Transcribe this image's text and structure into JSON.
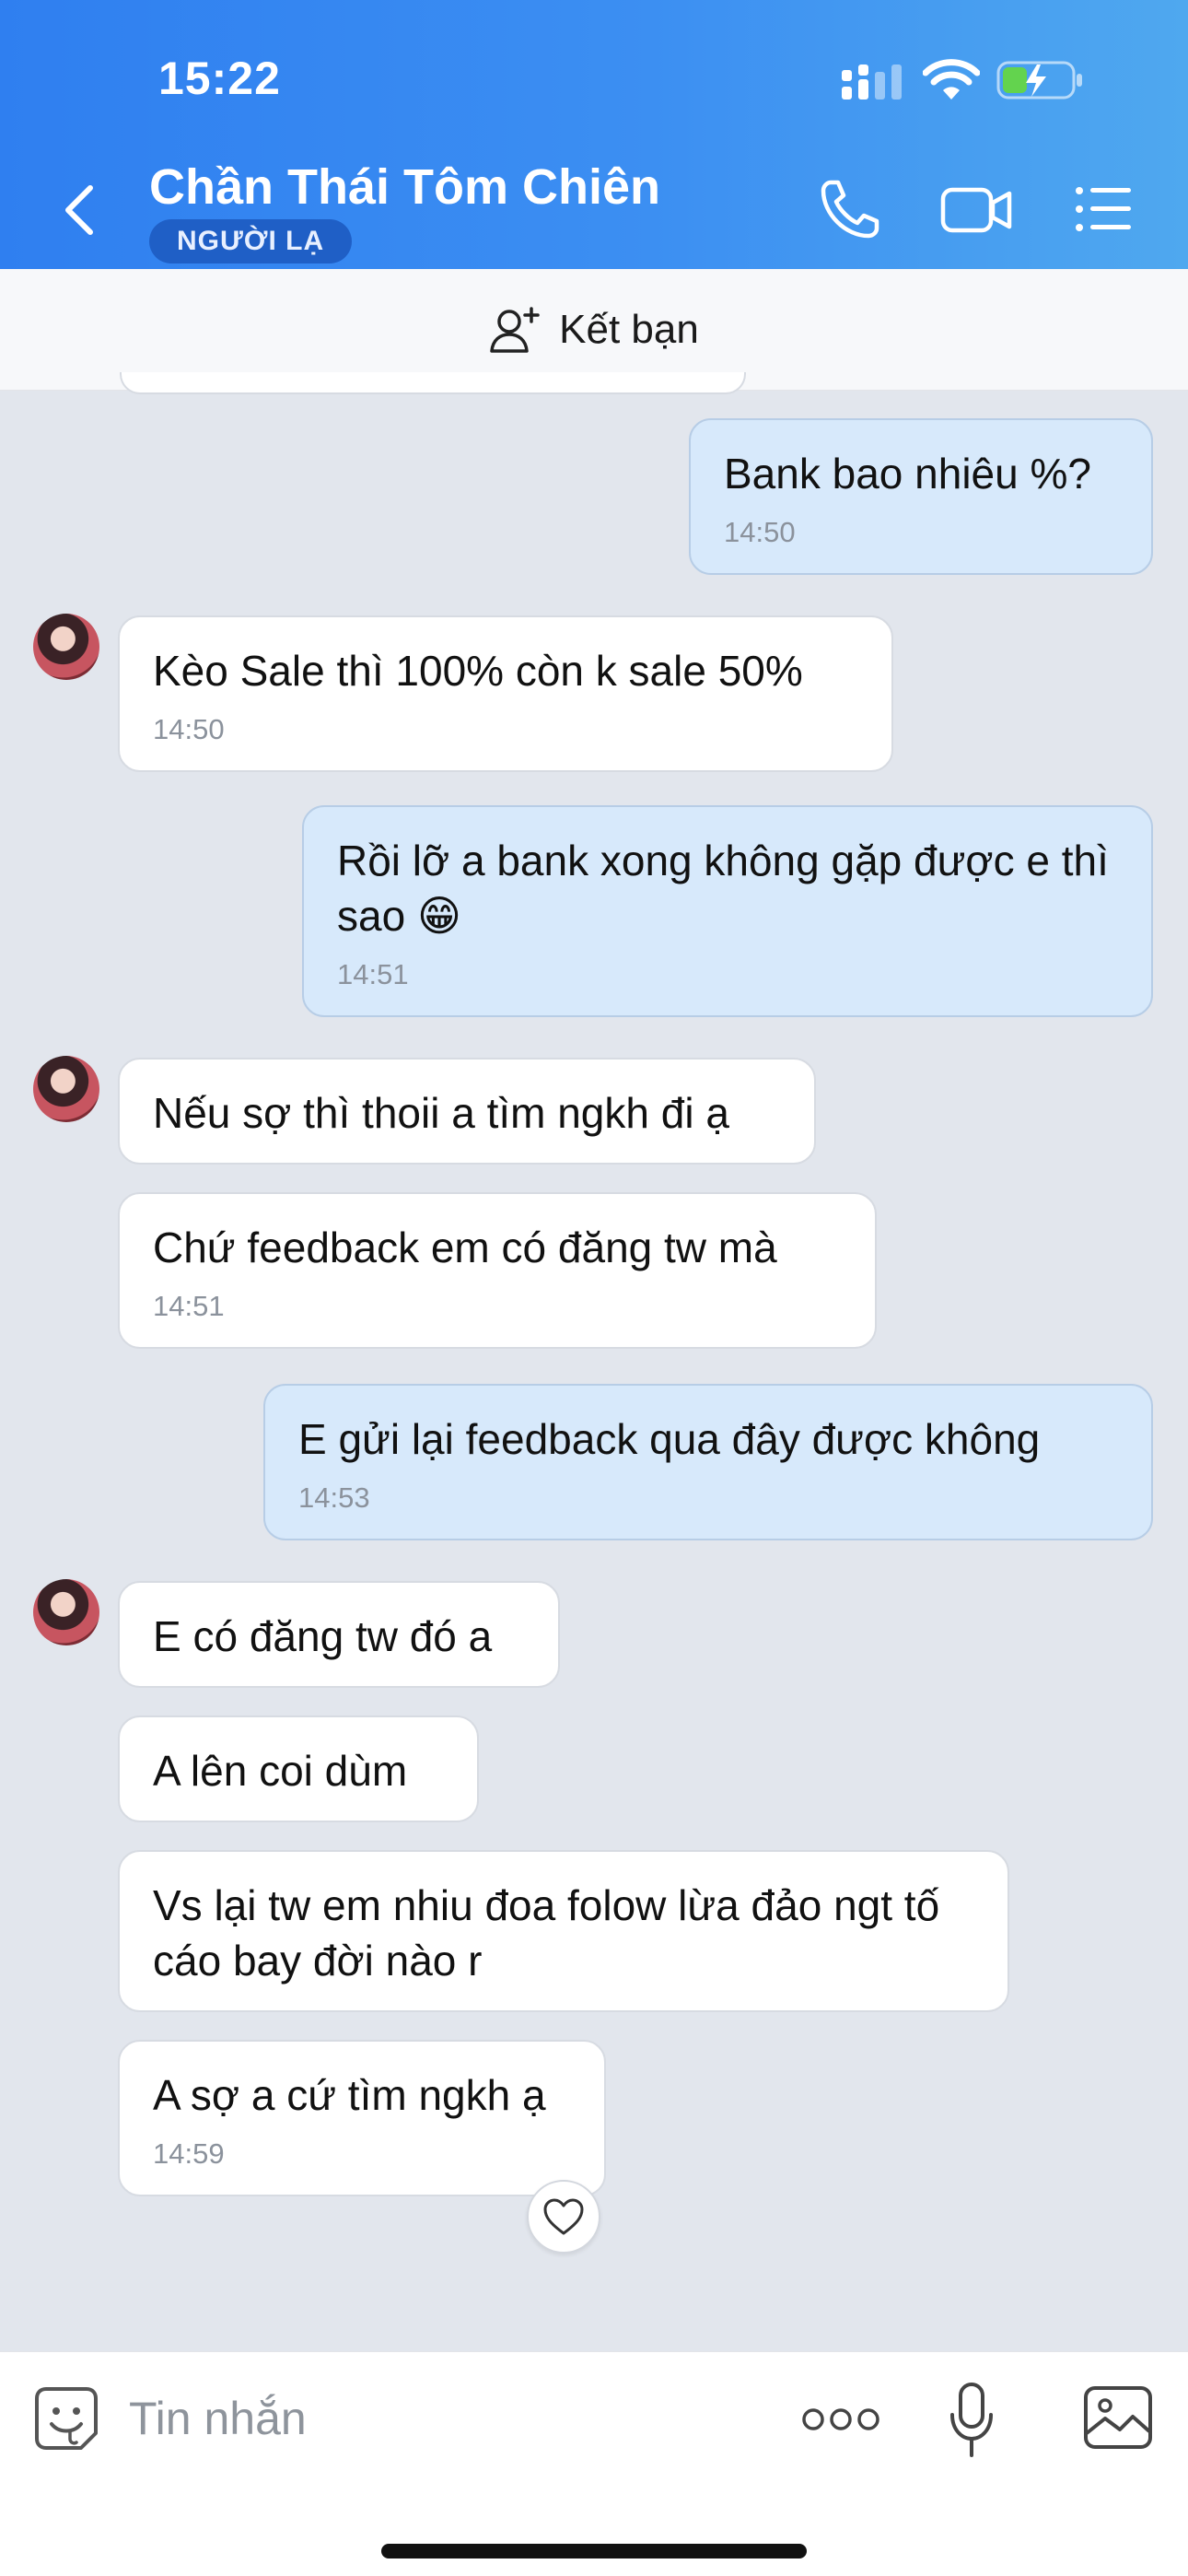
{
  "status_bar": {
    "time": "15:22"
  },
  "header": {
    "contact_name": "Chần Thái Tôm Chiên",
    "badge": "NGƯỜI LẠ"
  },
  "friend_bar": {
    "label": "Kết bạn"
  },
  "messages": [
    {
      "from": "me",
      "text": "Bank bao nhiêu %?",
      "time": "14:50"
    },
    {
      "from": "them",
      "text": "Kèo Sale thì 100% còn k sale 50%",
      "time": "14:50"
    },
    {
      "from": "me",
      "text": "Rồi lỡ a bank xong không gặp được e thì sao 😁",
      "time": "14:51"
    },
    {
      "from": "them",
      "text": "Nếu sợ thì thoii a tìm ngkh đi ạ",
      "time": ""
    },
    {
      "from": "them",
      "text": "Chứ feedback em có đăng tw mà",
      "time": "14:51"
    },
    {
      "from": "me",
      "text": "E gửi lại feedback qua đây được không",
      "time": "14:53"
    },
    {
      "from": "them",
      "text": "E có đăng tw đó a",
      "time": ""
    },
    {
      "from": "them",
      "text": "A lên coi dùm",
      "time": ""
    },
    {
      "from": "them",
      "text": "Vs lại tw em nhiu đoa folow lừa đảo ngt tố cáo bay đời nào r",
      "time": ""
    },
    {
      "from": "them",
      "text": "A sợ a cứ tìm ngkh ạ",
      "time": "14:59"
    }
  ],
  "input_bar": {
    "placeholder": "Tin nhắn"
  },
  "colors": {
    "header_start": "#2f7ff0",
    "header_end": "#4fa8ef",
    "out_bubble": "#d7e9fb",
    "in_bubble": "#ffffff",
    "chat_bg": "#e2e6ed"
  }
}
